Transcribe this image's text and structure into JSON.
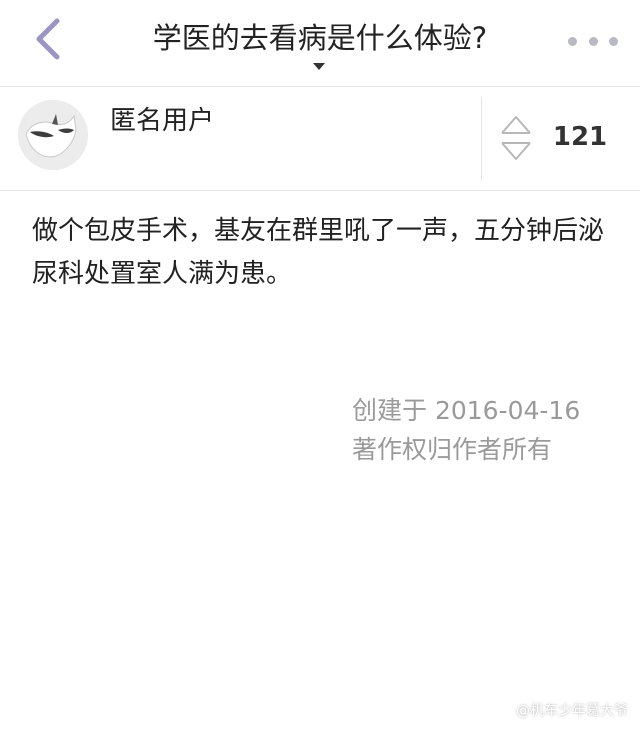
{
  "nav": {
    "back_icon": "chevron-left-icon",
    "title": "学医的去看病是什么体验?",
    "more_icon": "more-dots-icon"
  },
  "author": {
    "name": "匿名用户",
    "avatar_icon": "anonymous-avatar"
  },
  "vote": {
    "count": "121",
    "icon": "up-down-vote-icon"
  },
  "answer": {
    "body": "做个包皮手术，基友在群里吼了一声，五分钟后泌尿科处置室人满为患。",
    "created": "创建于 2016-04-16",
    "copyright": "著作权归作者所有"
  },
  "watermark": {
    "text": "@机车少年葛大爷"
  },
  "colors": {
    "accent": "#9b95c4",
    "text": "#222222",
    "meta_text": "#9a9a9a",
    "divider": "#e3e3e3"
  }
}
